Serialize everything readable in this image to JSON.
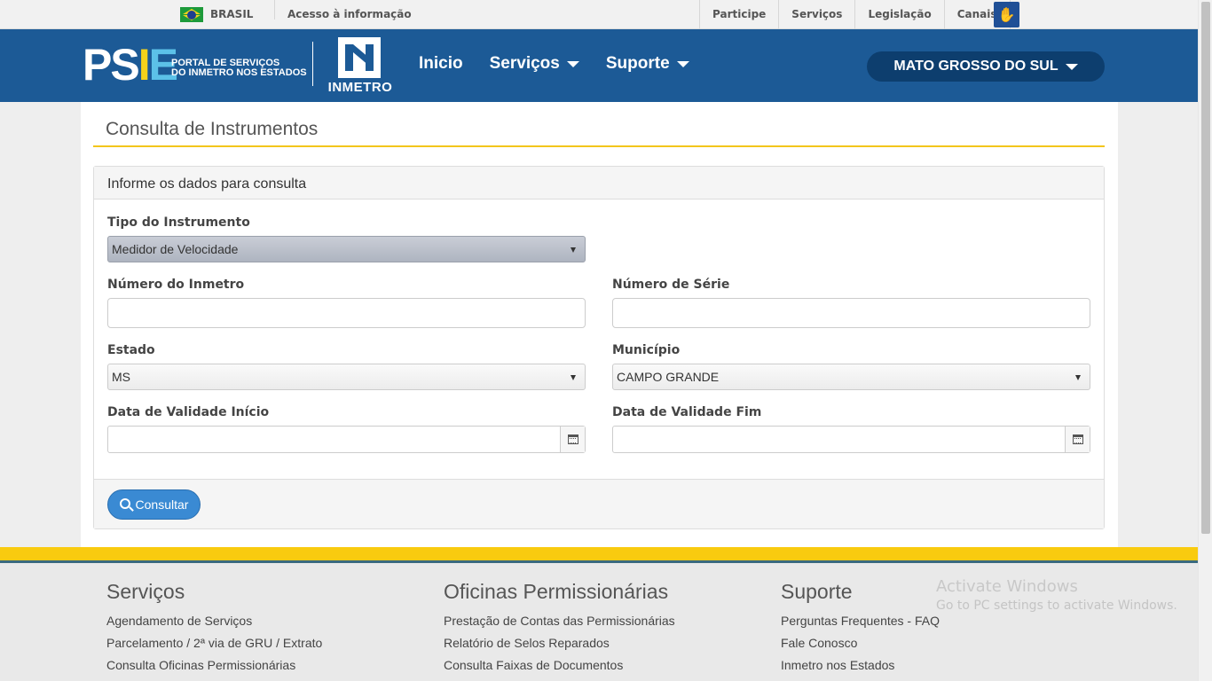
{
  "gov_bar": {
    "country": "BRASIL",
    "access_info": "Acesso à informação",
    "links": [
      "Participe",
      "Serviços",
      "Legislação",
      "Canais"
    ]
  },
  "header": {
    "logo_text": "PSIE",
    "portal_line1": "PORTAL DE SERVIÇOS",
    "portal_line2": "DO INMETRO NOS ESTADOS",
    "inmetro_text": "INMETRO",
    "nav": [
      "Inicio",
      "Serviços",
      "Suporte"
    ],
    "state": "MATO GROSSO DO SUL"
  },
  "page": {
    "title": "Consulta de Instrumentos",
    "panel_title": "Informe os dados para consulta",
    "fields": {
      "tipo_label": "Tipo do Instrumento",
      "tipo_value": "Medidor de Velocidade",
      "numero_inmetro_label": "Número do Inmetro",
      "numero_inmetro_value": "",
      "numero_serie_label": "Número de Série",
      "numero_serie_value": "",
      "estado_label": "Estado",
      "estado_value": "MS",
      "municipio_label": "Município",
      "municipio_value": "CAMPO GRANDE",
      "data_inicio_label": "Data de Validade Início",
      "data_fim_label": "Data de Validade Fim"
    },
    "submit_label": "Consultar"
  },
  "footer": {
    "columns": [
      {
        "title": "Serviços",
        "links": [
          "Agendamento de Serviços",
          "Parcelamento / 2ª via de GRU / Extrato",
          "Consulta Oficinas Permissionárias"
        ]
      },
      {
        "title": "Oficinas Permissionárias",
        "links": [
          "Prestação de Contas das Permissionárias",
          "Relatório de Selos Reparados",
          "Consulta Faixas de Documentos"
        ]
      },
      {
        "title": "Suporte",
        "links": [
          "Perguntas Frequentes - FAQ",
          "Fale Conosco",
          "Inmetro nos Estados"
        ]
      }
    ]
  },
  "watermark": {
    "line1": "Activate Windows",
    "line2": "Go to PC settings to activate Windows."
  },
  "colors": {
    "header_blue": "#1c5a96",
    "accent_yellow": "#f3c61b",
    "button_blue": "#3a8ad3"
  }
}
